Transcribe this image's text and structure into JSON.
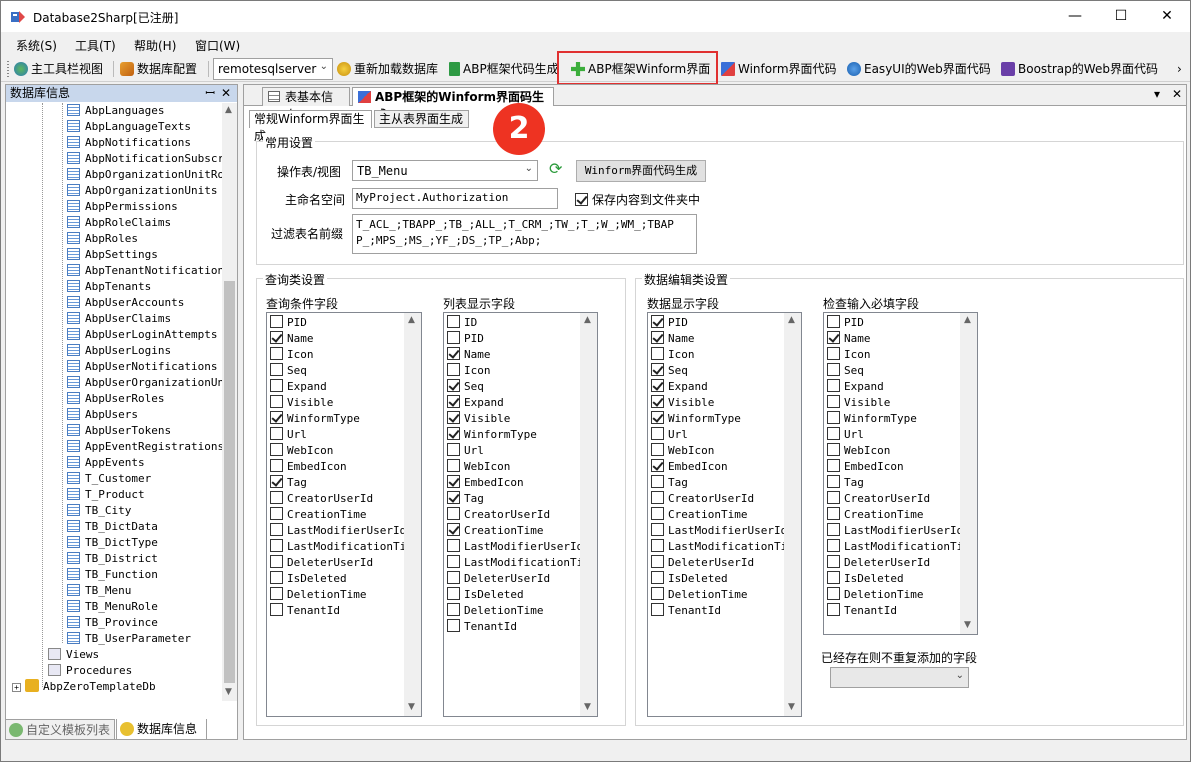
{
  "window": {
    "title": "Database2Sharp[已注册]",
    "minimize": "—",
    "maximize": "☐",
    "close": "✕"
  },
  "menu": [
    "系统(S)",
    "工具(T)",
    "帮助(H)",
    "窗口(W)"
  ],
  "toolbar": {
    "main_toolbar_view": "主工具栏视图",
    "db_config": "数据库配置",
    "server": "remotesqlserver",
    "reload_db": "重新加载数据库",
    "abp_code_gen": "ABP框架代码生成",
    "abp_winform": "ABP框架Winform界面",
    "winform_code": "Winform界面代码",
    "easyui_code": "EasyUI的Web界面代码",
    "bootstrap_code": "Boostrap的Web界面代码",
    "more": "›"
  },
  "left_panel": {
    "title": "数据库信息",
    "pin": "ꟷ",
    "close": "✕",
    "tables": [
      "AbpLanguages",
      "AbpLanguageTexts",
      "AbpNotifications",
      "AbpNotificationSubscri",
      "AbpOrganizationUnitRol",
      "AbpOrganizationUnits",
      "AbpPermissions",
      "AbpRoleClaims",
      "AbpRoles",
      "AbpSettings",
      "AbpTenantNotifications",
      "AbpTenants",
      "AbpUserAccounts",
      "AbpUserClaims",
      "AbpUserLoginAttempts",
      "AbpUserLogins",
      "AbpUserNotifications",
      "AbpUserOrganizationUni",
      "AbpUserRoles",
      "AbpUsers",
      "AbpUserTokens",
      "AppEventRegistrations",
      "AppEvents",
      "T_Customer",
      "T_Product",
      "TB_City",
      "TB_DictData",
      "TB_DictType",
      "TB_District",
      "TB_Function",
      "TB_Menu",
      "TB_MenuRole",
      "TB_Province",
      "TB_UserParameter"
    ],
    "views": "Views",
    "procedures": "Procedures",
    "database": "AbpZeroTemplateDb",
    "tabs": [
      "自定义模板列表",
      "数据库信息"
    ]
  },
  "doc_tabs": [
    "表基本信息",
    "ABP框架的Winform界面码生成"
  ],
  "doc_menu": "▾",
  "doc_close": "✕",
  "sub_tabs": [
    "常规Winform界面生成",
    "主从表界面生成"
  ],
  "badge": "2",
  "common": {
    "title": "常用设置",
    "table_label": "操作表/视图",
    "table_value": "TB_Menu",
    "refresh": "⟳",
    "gen_button": "Winform界面代码生成",
    "namespace_label": "主命名空间",
    "namespace_value": "MyProject.Authorization",
    "save_folder": "保存内容到文件夹中",
    "prefix_label": "过滤表名前缀",
    "prefix_value": "T_ACL_;TBAPP_;TB_;ALL_;T_CRM_;TW_;T_;W_;WM_;TBAPP_;MPS_;MS_;YF_;DS_;TP_;Abp;"
  },
  "query_group": {
    "title": "查询类设置",
    "cond_label": "查询条件字段",
    "list_label": "列表显示字段",
    "cond_items": [
      {
        "t": "PID",
        "c": false
      },
      {
        "t": "Name",
        "c": true
      },
      {
        "t": "Icon",
        "c": false
      },
      {
        "t": "Seq",
        "c": false
      },
      {
        "t": "Expand",
        "c": false
      },
      {
        "t": "Visible",
        "c": false
      },
      {
        "t": "WinformType",
        "c": true
      },
      {
        "t": "Url",
        "c": false
      },
      {
        "t": "WebIcon",
        "c": false
      },
      {
        "t": "EmbedIcon",
        "c": false
      },
      {
        "t": "Tag",
        "c": true
      },
      {
        "t": "CreatorUserId",
        "c": false
      },
      {
        "t": "CreationTime",
        "c": false
      },
      {
        "t": "LastModifierUserId",
        "c": false
      },
      {
        "t": "LastModificationTim",
        "c": false
      },
      {
        "t": "DeleterUserId",
        "c": false
      },
      {
        "t": "IsDeleted",
        "c": false
      },
      {
        "t": "DeletionTime",
        "c": false
      },
      {
        "t": "TenantId",
        "c": false
      }
    ],
    "list_items": [
      {
        "t": "ID",
        "c": false
      },
      {
        "t": "PID",
        "c": false
      },
      {
        "t": "Name",
        "c": true
      },
      {
        "t": "Icon",
        "c": false
      },
      {
        "t": "Seq",
        "c": true
      },
      {
        "t": "Expand",
        "c": true
      },
      {
        "t": "Visible",
        "c": true
      },
      {
        "t": "WinformType",
        "c": true
      },
      {
        "t": "Url",
        "c": false
      },
      {
        "t": "WebIcon",
        "c": false
      },
      {
        "t": "EmbedIcon",
        "c": true
      },
      {
        "t": "Tag",
        "c": true
      },
      {
        "t": "CreatorUserId",
        "c": false
      },
      {
        "t": "CreationTime",
        "c": true
      },
      {
        "t": "LastModifierUserId",
        "c": false
      },
      {
        "t": "LastModificationTim",
        "c": false
      },
      {
        "t": "DeleterUserId",
        "c": false
      },
      {
        "t": "IsDeleted",
        "c": false
      },
      {
        "t": "DeletionTime",
        "c": false
      },
      {
        "t": "TenantId",
        "c": false
      }
    ]
  },
  "edit_group": {
    "title": "数据编辑类设置",
    "display_label": "数据显示字段",
    "required_label": "检查输入必填字段",
    "nodup_label": "已经存在则不重复添加的字段",
    "display_items": [
      {
        "t": "PID",
        "c": true
      },
      {
        "t": "Name",
        "c": true
      },
      {
        "t": "Icon",
        "c": false
      },
      {
        "t": "Seq",
        "c": true
      },
      {
        "t": "Expand",
        "c": true
      },
      {
        "t": "Visible",
        "c": true
      },
      {
        "t": "WinformType",
        "c": true
      },
      {
        "t": "Url",
        "c": false
      },
      {
        "t": "WebIcon",
        "c": false
      },
      {
        "t": "EmbedIcon",
        "c": true
      },
      {
        "t": "Tag",
        "c": false
      },
      {
        "t": "CreatorUserId",
        "c": false
      },
      {
        "t": "CreationTime",
        "c": false
      },
      {
        "t": "LastModifierUserId",
        "c": false
      },
      {
        "t": "LastModificationTim",
        "c": false
      },
      {
        "t": "DeleterUserId",
        "c": false
      },
      {
        "t": "IsDeleted",
        "c": false
      },
      {
        "t": "DeletionTime",
        "c": false
      },
      {
        "t": "TenantId",
        "c": false
      }
    ],
    "required_items": [
      {
        "t": "PID",
        "c": false
      },
      {
        "t": "Name",
        "c": true
      },
      {
        "t": "Icon",
        "c": false
      },
      {
        "t": "Seq",
        "c": false
      },
      {
        "t": "Expand",
        "c": false
      },
      {
        "t": "Visible",
        "c": false
      },
      {
        "t": "WinformType",
        "c": false
      },
      {
        "t": "Url",
        "c": false
      },
      {
        "t": "WebIcon",
        "c": false
      },
      {
        "t": "EmbedIcon",
        "c": false
      },
      {
        "t": "Tag",
        "c": false
      },
      {
        "t": "CreatorUserId",
        "c": false
      },
      {
        "t": "CreationTime",
        "c": false
      },
      {
        "t": "LastModifierUserId",
        "c": false
      },
      {
        "t": "LastModificationTim",
        "c": false
      },
      {
        "t": "DeleterUserId",
        "c": false
      },
      {
        "t": "IsDeleted",
        "c": false
      },
      {
        "t": "DeletionTime",
        "c": false
      },
      {
        "t": "TenantId",
        "c": false
      }
    ]
  },
  "colors": {
    "highlight": "#e03030",
    "badge": "#ee3322",
    "panel_header": "#c8d7ec"
  }
}
